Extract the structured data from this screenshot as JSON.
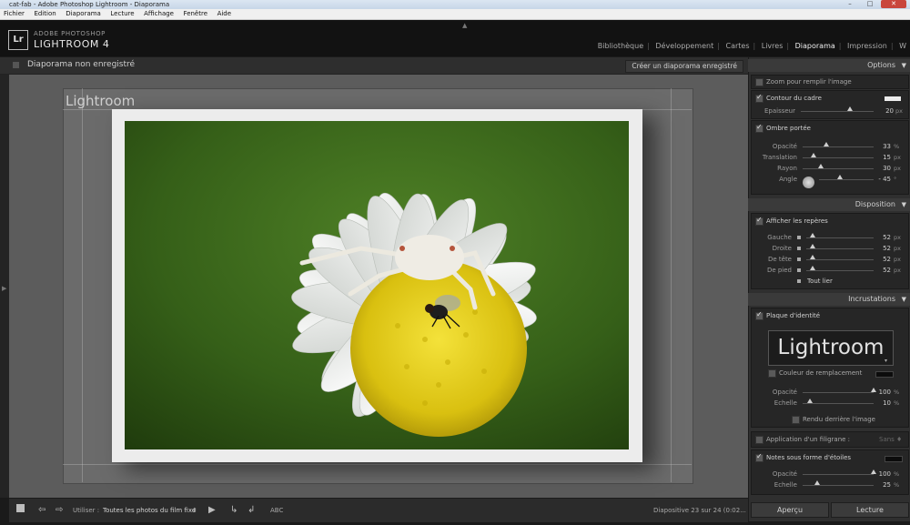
{
  "window": {
    "title": "cat-fab - Adobe Photoshop Lightroom - Diaporama",
    "controls": [
      "–",
      "□",
      "✕"
    ]
  },
  "menu": [
    "Fichier",
    "Edition",
    "Diaporama",
    "Lecture",
    "Affichage",
    "Fenêtre",
    "Aide"
  ],
  "header": {
    "logo": "Lr",
    "brand_small": "ADOBE PHOTOSHOP",
    "brand_large": "LIGHTROOM 4",
    "modules": [
      "Bibliothèque",
      "Développement",
      "Cartes",
      "Livres",
      "Diaporama",
      "Impression",
      "W"
    ],
    "active_module": "Diaporama"
  },
  "topbar": {
    "title": "Diaporama non enregistré",
    "create_button": "Créer un diaporama enregistré"
  },
  "stage": {
    "identity_plate": "Lightroom"
  },
  "bottombar": {
    "use_label": "Utiliser :",
    "use_value": "Toutes les photos du film fixe",
    "abc": "ABC",
    "status": "Diapositive 23 sur 24 (0:02..."
  },
  "panel": {
    "options": {
      "title": "Options",
      "zoom_fill": "Zoom pour remplir l'image",
      "stroke_border": "Contour du cadre",
      "thickness": {
        "label": "Epaisseur",
        "value": "20",
        "unit": "px",
        "level": 0.67
      },
      "drop_shadow": "Ombre portée",
      "opacity": {
        "label": "Opacité",
        "value": "33",
        "unit": "%",
        "level": 0.33
      },
      "offset": {
        "label": "Translation",
        "value": "15",
        "unit": "px",
        "level": 0.15
      },
      "radius": {
        "label": "Rayon",
        "value": "30",
        "unit": "px",
        "level": 0.25
      },
      "angle": {
        "label": "Angle",
        "value": "- 45",
        "unit": "°",
        "level": 0.375
      }
    },
    "layout": {
      "title": "Disposition",
      "show_guides": "Afficher les repères",
      "left": {
        "label": "Gauche",
        "value": "52",
        "unit": "px",
        "level": 0.1
      },
      "right": {
        "label": "Droite",
        "value": "52",
        "unit": "px",
        "level": 0.1
      },
      "top": {
        "label": "De tête",
        "value": "52",
        "unit": "px",
        "level": 0.1
      },
      "bottom": {
        "label": "De pied",
        "value": "52",
        "unit": "px",
        "level": 0.1
      },
      "link_all": "Tout lier"
    },
    "overlays": {
      "title": "Incrustations",
      "identity_plate": "Plaque d'identité",
      "identity_preview": "Lightroom",
      "override_color": "Couleur de remplacement",
      "opacity": {
        "label": "Opacité",
        "value": "100",
        "unit": "%",
        "level": 1.0
      },
      "scale": {
        "label": "Echelle",
        "value": "10",
        "unit": "%",
        "level": 0.1
      },
      "render_behind": "Rendu derrière l'image",
      "watermark": "Application d'un filigrane :",
      "watermark_value": "Sans ♦",
      "star_ratings": "Notes sous forme d'étoiles",
      "stars_opacity": {
        "label": "Opacité",
        "value": "100",
        "unit": "%",
        "level": 1.0
      },
      "stars_scale": {
        "label": "Echelle",
        "value": "25",
        "unit": "%",
        "level": 0.2
      }
    }
  },
  "buttons": {
    "preview": "Aperçu",
    "play": "Lecture"
  },
  "colors": {
    "panel_bg": "#2f2f2f",
    "stage_bg": "#5c5c5c",
    "frame": "#ececec",
    "flower_center": "#e8d21a",
    "petal": "#f5f5f5",
    "background_green": "#3f6b1e"
  }
}
